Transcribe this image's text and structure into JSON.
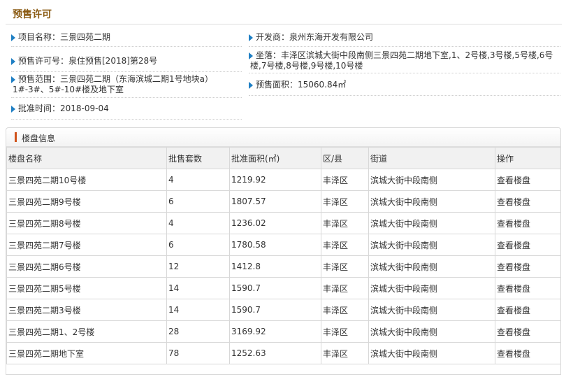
{
  "page": {
    "title": "预售许可"
  },
  "info": {
    "project_name": "项目名称：三景四苑二期",
    "developer": "开发商：泉州东海开发有限公司",
    "license_no": "预售许可号：泉住预售[2018]第28号",
    "location_line1": "坐落：丰泽区滨城大街中段南侧三景四苑二期地下室,1、2号楼,3号楼,5号楼,6号",
    "location_line2": "楼,7号楼,8号楼,9号楼,10号楼",
    "scope_line1": "预售范围：三景四苑二期（东海滨城二期1号地块a）",
    "scope_line2": "1#-3#、5#-10#楼及地下室",
    "area": "预售面积：15060.84㎡",
    "approval_time": "批准时间：2018-09-04"
  },
  "panel": {
    "title": "楼盘信息"
  },
  "table": {
    "headers": [
      "楼盘名称",
      "批售套数",
      "批准面积(㎡)",
      "区/县",
      "街道",
      "操作"
    ],
    "rows": [
      [
        "三景四苑二期10号楼",
        "4",
        "1219.92",
        "丰泽区",
        "滨城大街中段南侧",
        "查看楼盘"
      ],
      [
        "三景四苑二期9号楼",
        "6",
        "1807.57",
        "丰泽区",
        "滨城大街中段南侧",
        "查看楼盘"
      ],
      [
        "三景四苑二期8号楼",
        "4",
        "1236.02",
        "丰泽区",
        "滨城大街中段南侧",
        "查看楼盘"
      ],
      [
        "三景四苑二期7号楼",
        "6",
        "1780.58",
        "丰泽区",
        "滨城大街中段南侧",
        "查看楼盘"
      ],
      [
        "三景四苑二期6号楼",
        "12",
        "1412.8",
        "丰泽区",
        "滨城大街中段南侧",
        "查看楼盘"
      ],
      [
        "三景四苑二期5号楼",
        "14",
        "1590.7",
        "丰泽区",
        "滨城大街中段南侧",
        "查看楼盘"
      ],
      [
        "三景四苑二期3号楼",
        "14",
        "1590.7",
        "丰泽区",
        "滨城大街中段南侧",
        "查看楼盘"
      ],
      [
        "三景四苑二期1、2号楼",
        "28",
        "3169.92",
        "丰泽区",
        "滨城大街中段南侧",
        "查看楼盘"
      ],
      [
        "三景四苑二期地下室",
        "78",
        "1252.63",
        "丰泽区",
        "滨城大街中段南侧",
        "查看楼盘"
      ]
    ]
  }
}
